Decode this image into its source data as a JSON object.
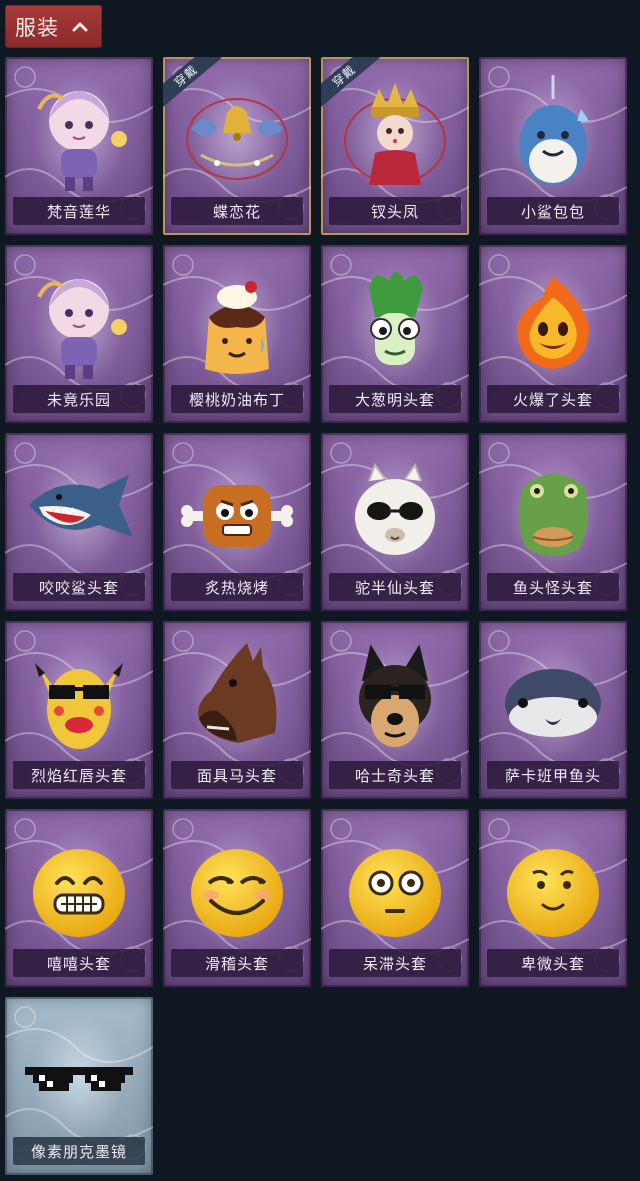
{
  "header": {
    "label": "服装",
    "icon": "chevron-up-icon",
    "bg_color": "#a0353a"
  },
  "badge_text": "穿戴",
  "items": [
    {
      "name": "梵音莲华",
      "icon": "character-costume-icon",
      "equipped": false
    },
    {
      "name": "蝶恋花",
      "icon": "bell-ornament-icon",
      "equipped": true
    },
    {
      "name": "钗头凤",
      "icon": "phoenix-crown-costume-icon",
      "equipped": true
    },
    {
      "name": "小鲨包包",
      "icon": "shark-bag-icon",
      "equipped": false
    },
    {
      "name": "未竟乐园",
      "icon": "character-costume-icon",
      "equipped": false
    },
    {
      "name": "樱桃奶油布丁",
      "icon": "pudding-head-icon",
      "equipped": false
    },
    {
      "name": "大葱明头套",
      "icon": "scallion-head-icon",
      "equipped": false
    },
    {
      "name": "火爆了头套",
      "icon": "fire-head-icon",
      "equipped": false
    },
    {
      "name": "咬咬鲨头套",
      "icon": "shark-head-icon",
      "equipped": false
    },
    {
      "name": "炙热烧烤",
      "icon": "grill-meat-head-icon",
      "equipped": false
    },
    {
      "name": "驼半仙头套",
      "icon": "alpaca-head-icon",
      "equipped": false
    },
    {
      "name": "鱼头怪头套",
      "icon": "fish-head-icon",
      "equipped": false
    },
    {
      "name": "烈焰红唇头套",
      "icon": "lips-mask-icon",
      "equipped": false
    },
    {
      "name": "面具马头套",
      "icon": "horse-head-icon",
      "equipped": false
    },
    {
      "name": "哈士奇头套",
      "icon": "husky-head-icon",
      "equipped": false
    },
    {
      "name": "萨卡班甲鱼头",
      "icon": "sacabambaspis-head-icon",
      "equipped": false
    },
    {
      "name": "嘻嘻头套",
      "icon": "grin-emoji-head-icon",
      "equipped": false
    },
    {
      "name": "滑稽头套",
      "icon": "smirk-emoji-head-icon",
      "equipped": false
    },
    {
      "name": "呆滞头套",
      "icon": "dazed-emoji-head-icon",
      "equipped": false
    },
    {
      "name": "卑微头套",
      "icon": "humble-emoji-head-icon",
      "equipped": false
    },
    {
      "name": "像素朋克墨镜",
      "icon": "pixel-sunglasses-icon",
      "equipped": false,
      "theme": "blue"
    }
  ],
  "colors": {
    "background": "#0f1723",
    "card_purple": "#7e5b98",
    "card_blue": "#98adbd",
    "equipped_border": "#b89552",
    "badge_bg": "#2f3e56"
  }
}
